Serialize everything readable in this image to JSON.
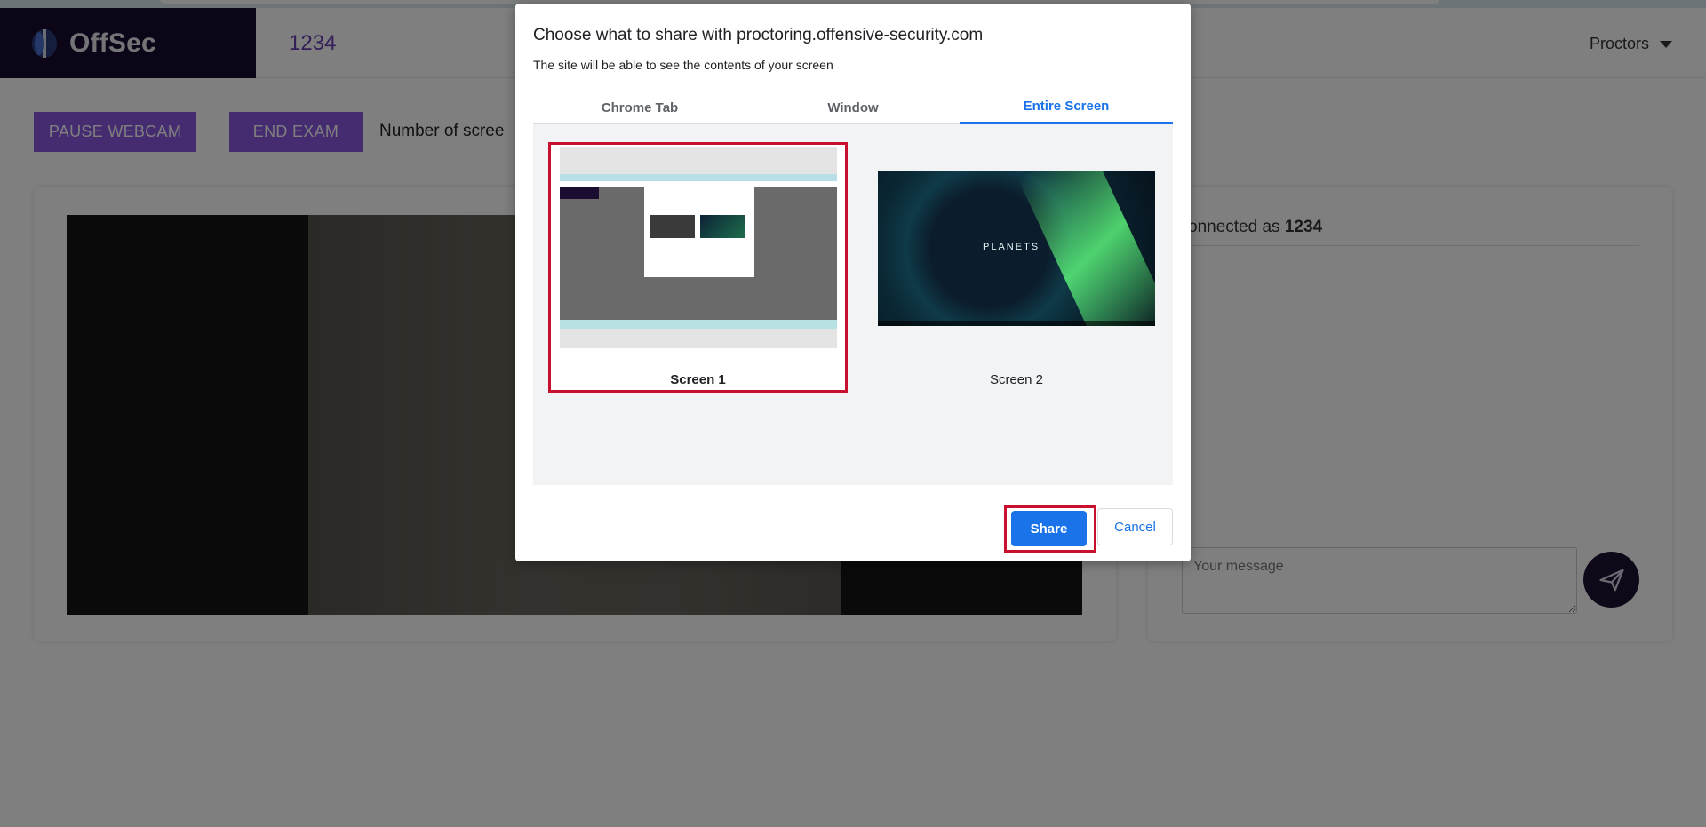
{
  "header": {
    "logo_text": "OffSec",
    "exam_id": "1234",
    "proctors_label": "Proctors"
  },
  "actions": {
    "pause_webcam": "PAUSE WEBCAM",
    "end_exam": "END EXAM",
    "screens_label": "Number of scree"
  },
  "chat": {
    "connected_prefix": "onnected as",
    "connected_user": "1234",
    "message_placeholder": "Your message"
  },
  "dialog": {
    "title": "Choose what to share with proctoring.offensive-security.com",
    "subtitle": "The site will be able to see the contents of your screen",
    "tabs": [
      {
        "label": "Chrome Tab",
        "selected": false
      },
      {
        "label": "Window",
        "selected": false
      },
      {
        "label": "Entire Screen",
        "selected": true
      }
    ],
    "screens": [
      {
        "label": "Screen 1",
        "selected": true
      },
      {
        "label": "Screen 2",
        "selected": false
      }
    ],
    "screen2_watermark": "PLANETS",
    "share_label": "Share",
    "cancel_label": "Cancel"
  },
  "colors": {
    "brand_dark": "#160a2e",
    "brand_purple": "#8b58e0",
    "accent_blue": "#1a73e8",
    "highlight_red": "#c8102e"
  }
}
